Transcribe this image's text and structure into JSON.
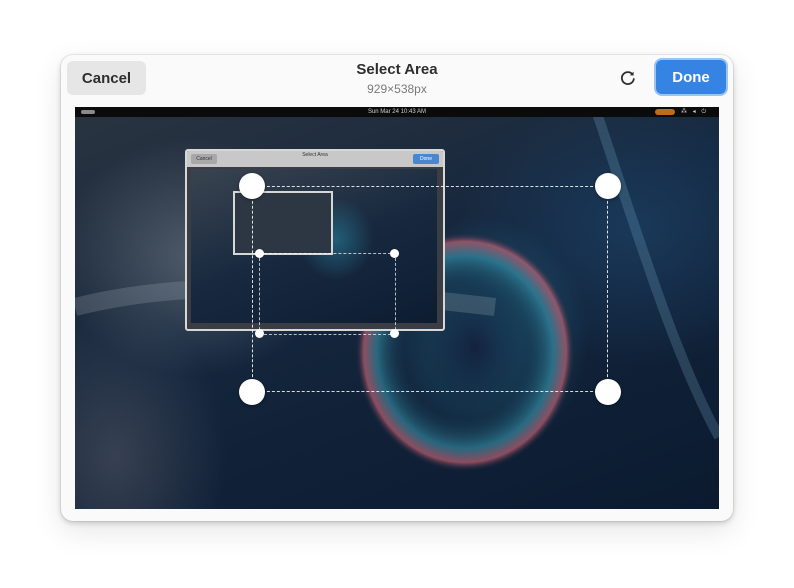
{
  "header": {
    "cancel_label": "Cancel",
    "title": "Select Area",
    "subtitle": "929×538px",
    "reset_icon": "refresh-icon",
    "done_label": "Done"
  },
  "screenshot_preview": {
    "topbar_clock": "Sun Mar 24  10:43 AM",
    "nested_dialog": {
      "cancel_label": "Cancel",
      "title": "Select Area",
      "done_label": "Done"
    }
  },
  "colors": {
    "accent": "#3584e4",
    "dialog_bg": "#fafafa",
    "cancel_bg": "#e6e6e6"
  }
}
